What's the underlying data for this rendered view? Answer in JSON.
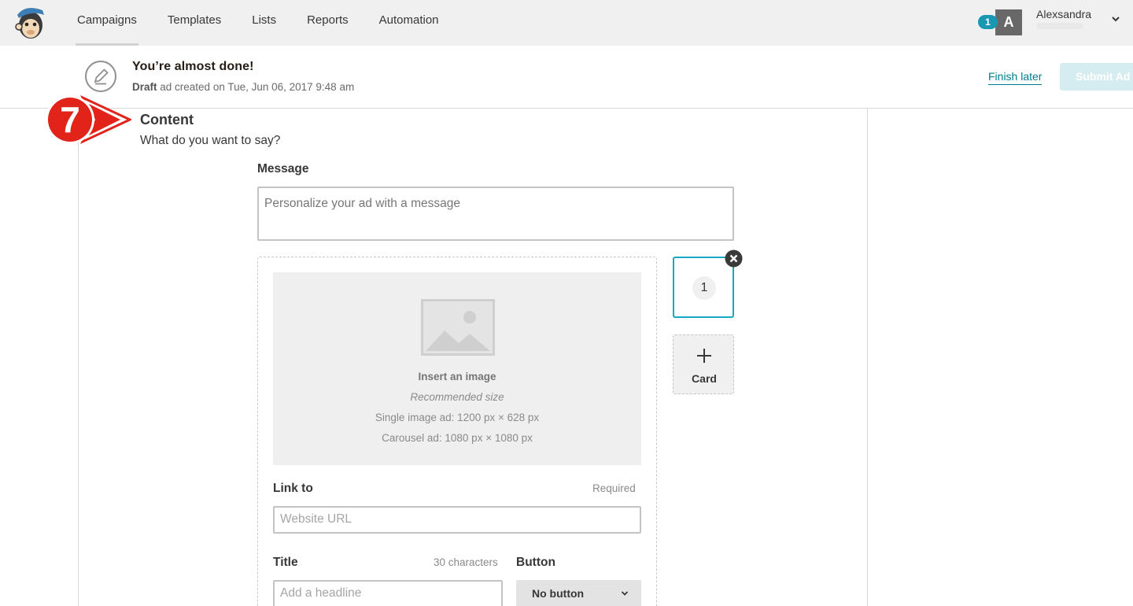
{
  "nav": {
    "items": [
      "Campaigns",
      "Templates",
      "Lists",
      "Reports",
      "Automation"
    ],
    "active": "Campaigns"
  },
  "account": {
    "notification_count": "1",
    "avatar_letter": "A",
    "name": "Alexsandra"
  },
  "status": {
    "title": "You’re almost done!",
    "draft_label": "Draft",
    "draft_text": " ad created on Tue, Jun 06, 2017 9:48 am",
    "finish_later": "Finish later",
    "submit": "Submit Ad"
  },
  "step": {
    "number": "7"
  },
  "content": {
    "title": "Content",
    "subtitle": "What do you want to say?",
    "message_label": "Message",
    "message_placeholder": "Personalize your ad with a message"
  },
  "image": {
    "insert": "Insert an image",
    "recommended": "Recommended size",
    "single": "Single image ad: 1200 px × 628 px",
    "carousel": "Carousel ad: 1080 px × 1080 px"
  },
  "link": {
    "label": "Link to",
    "required": "Required",
    "placeholder": "Website URL"
  },
  "title_field": {
    "label": "Title",
    "limit": "30 characters",
    "placeholder": "Add a headline"
  },
  "button_field": {
    "label": "Button",
    "value": "No button"
  },
  "cards": {
    "current_number": "1",
    "add_label": "Card"
  },
  "colors": {
    "accent": "#1aa7c2",
    "link": "#007c89",
    "step_badge": "#e2231a"
  }
}
